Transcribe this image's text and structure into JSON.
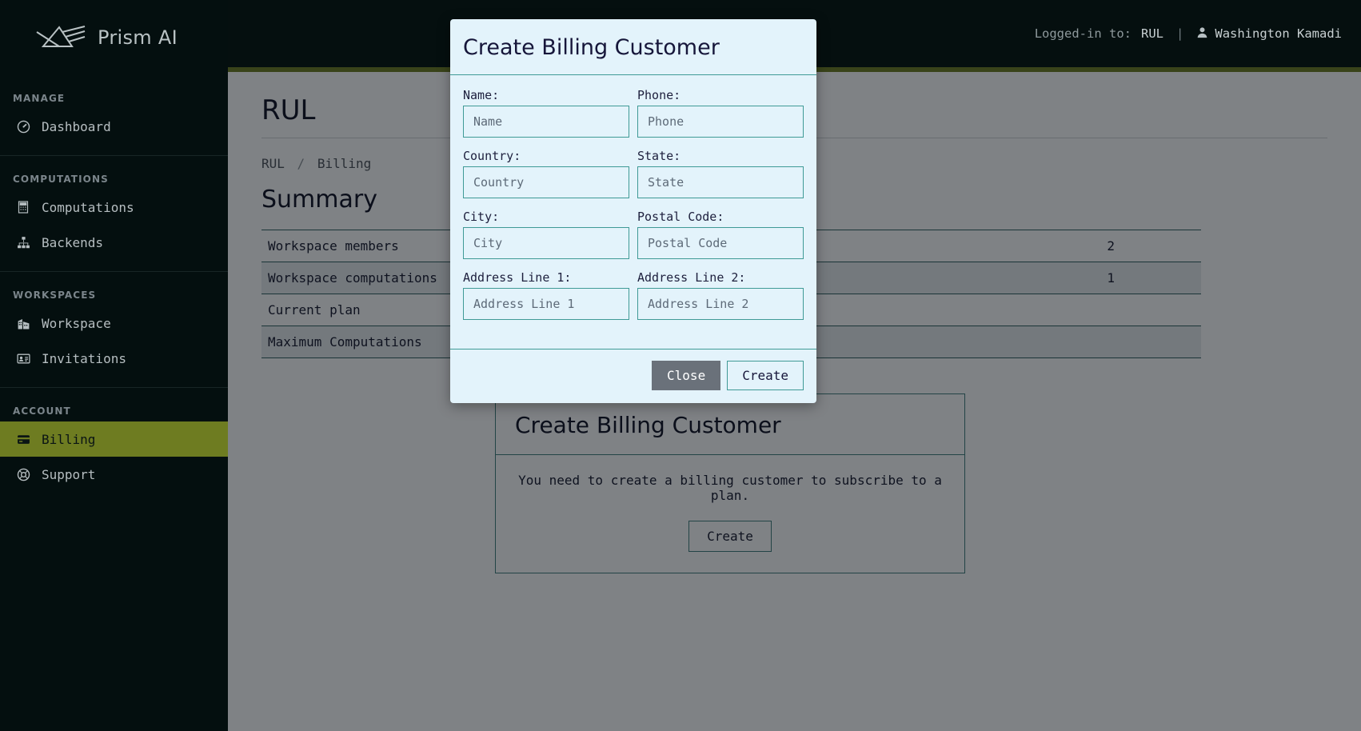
{
  "brand": {
    "name": "Prism AI",
    "logo_icon": "prism-logo-icon"
  },
  "topbar": {
    "logged_in_label": "Logged-in to:",
    "workspace": "RUL",
    "separator": "|",
    "user_icon": "user-icon",
    "user_name": "Washington Kamadi"
  },
  "sidebar": {
    "groups": [
      {
        "heading": "MANAGE",
        "items": [
          {
            "label": "Dashboard",
            "icon": "speedometer-icon",
            "active": false
          }
        ]
      },
      {
        "heading": "COMPUTATIONS",
        "items": [
          {
            "label": "Computations",
            "icon": "calculator-icon",
            "active": false
          },
          {
            "label": "Backends",
            "icon": "sitemap-icon",
            "active": false
          }
        ]
      },
      {
        "heading": "WORKSPACES",
        "items": [
          {
            "label": "Workspace",
            "icon": "building-icon",
            "active": false
          },
          {
            "label": "Invitations",
            "icon": "id-card-icon",
            "active": false
          }
        ]
      },
      {
        "heading": "ACCOUNT",
        "items": [
          {
            "label": "Billing",
            "icon": "credit-card-icon",
            "active": true
          },
          {
            "label": "Support",
            "icon": "life-ring-icon",
            "active": false
          }
        ]
      }
    ]
  },
  "main": {
    "page_title": "RUL",
    "breadcrumb": {
      "root": "RUL",
      "separator": "/",
      "current": "Billing"
    },
    "section_title": "Summary",
    "summary_rows": [
      {
        "label": "Workspace members",
        "value": "2"
      },
      {
        "label": "Workspace computations",
        "value": "1"
      },
      {
        "label": "Current plan",
        "value": ""
      },
      {
        "label": "Maximum Computations",
        "value": ""
      }
    ],
    "callout": {
      "title": "Create Billing Customer",
      "text": "You need to create a billing customer to subscribe to a plan.",
      "button": "Create"
    }
  },
  "modal": {
    "title": "Create Billing Customer",
    "rows": [
      [
        {
          "label": "Name:",
          "placeholder": "Name",
          "value": "",
          "name": "name-field"
        },
        {
          "label": "Phone:",
          "placeholder": "Phone",
          "value": "",
          "name": "phone-field"
        }
      ],
      [
        {
          "label": "Country:",
          "placeholder": "Country",
          "value": "",
          "name": "country-field"
        },
        {
          "label": "State:",
          "placeholder": "State",
          "value": "",
          "name": "state-field"
        }
      ],
      [
        {
          "label": "City:",
          "placeholder": "City",
          "value": "",
          "name": "city-field"
        },
        {
          "label": "Postal Code:",
          "placeholder": "Postal Code",
          "value": "",
          "name": "postal-code-field"
        }
      ],
      [
        {
          "label": "Address Line 1:",
          "placeholder": "Address Line 1",
          "value": "",
          "name": "address-line-1-field"
        },
        {
          "label": "Address Line 2:",
          "placeholder": "Address Line 2",
          "value": "",
          "name": "address-line-2-field"
        }
      ]
    ],
    "close_label": "Close",
    "create_label": "Create"
  },
  "colors": {
    "sidebar_bg": "#040f0f",
    "accent_olive": "#6e7c21",
    "modal_bg": "#e3f3fb",
    "modal_border": "#3f9a96",
    "close_btn": "#6a717a",
    "title_navy": "#16163a"
  }
}
